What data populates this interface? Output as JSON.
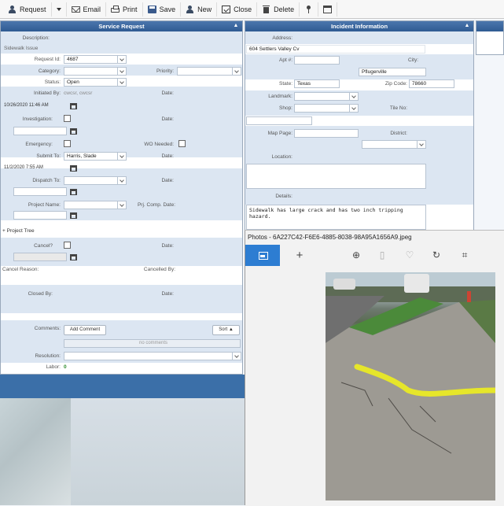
{
  "toolbar": {
    "request": "Request",
    "email": "Email",
    "print": "Print",
    "save": "Save",
    "new": "New",
    "close": "Close",
    "delete": "Delete"
  },
  "service_request": {
    "title": "Service Request",
    "description_label": "Description:",
    "description_value": "Sidewalk Issue",
    "request_id_label": "Request Id:",
    "request_id_value": "4687",
    "category_label": "Category:",
    "priority_label": "Priority:",
    "status_label": "Status:",
    "status_value": "Open",
    "initiated_by_label": "Initiated By:",
    "initiated_by_value": "cwcsr, cwcsr",
    "date_label": "Date:",
    "initiated_date": "10/26/2020 11:46 AM",
    "investigation_label": "Investigation:",
    "emergency_label": "Emergency:",
    "wo_needed_label": "WO Needed:",
    "submit_to_label": "Submit To:",
    "submit_to_value": "Harris, Slade",
    "submit_date": "11/2/2020 7:55 AM",
    "dispatch_to_label": "Dispatch To:",
    "project_name_label": "Project Name:",
    "prj_comp_date_label": "Prj. Comp. Date:",
    "project_tree": "Project Tree",
    "cancel_label": "Cancel?",
    "cancel_reason_label": "Cancel Reason:",
    "cancelled_by_label": "Cancelled By:",
    "closed_by_label": "Closed By:",
    "comments_label": "Comments:",
    "add_comment": "Add Comment",
    "sort": "Sort ▲",
    "no_comments": "no comments",
    "resolution_label": "Resolution:",
    "labor_label": "Labor:",
    "labor_value": "0"
  },
  "incident": {
    "title": "Incident Information",
    "address_label": "Address:",
    "address_value": "604 Settlers Valley Cv",
    "apt_label": "Apt #:",
    "city_label": "City:",
    "city_value": "Pflugerville",
    "state_label": "State:",
    "state_value": "Texas",
    "zip_label": "Zip Code:",
    "zip_value": "78660",
    "landmark_label": "Landmark:",
    "shop_label": "Shop:",
    "tile_no_label": "Tile No:",
    "map_page_label": "Map Page:",
    "district_label": "District:",
    "location_label": "Location:",
    "details_label": "Details:",
    "details_value": "Sidewalk has large crack and has two inch tripping hazard."
  },
  "photos": {
    "title": "Photos - 6A227C42-F6E6-4885-8038-98A95A1656A9.jpeg"
  }
}
